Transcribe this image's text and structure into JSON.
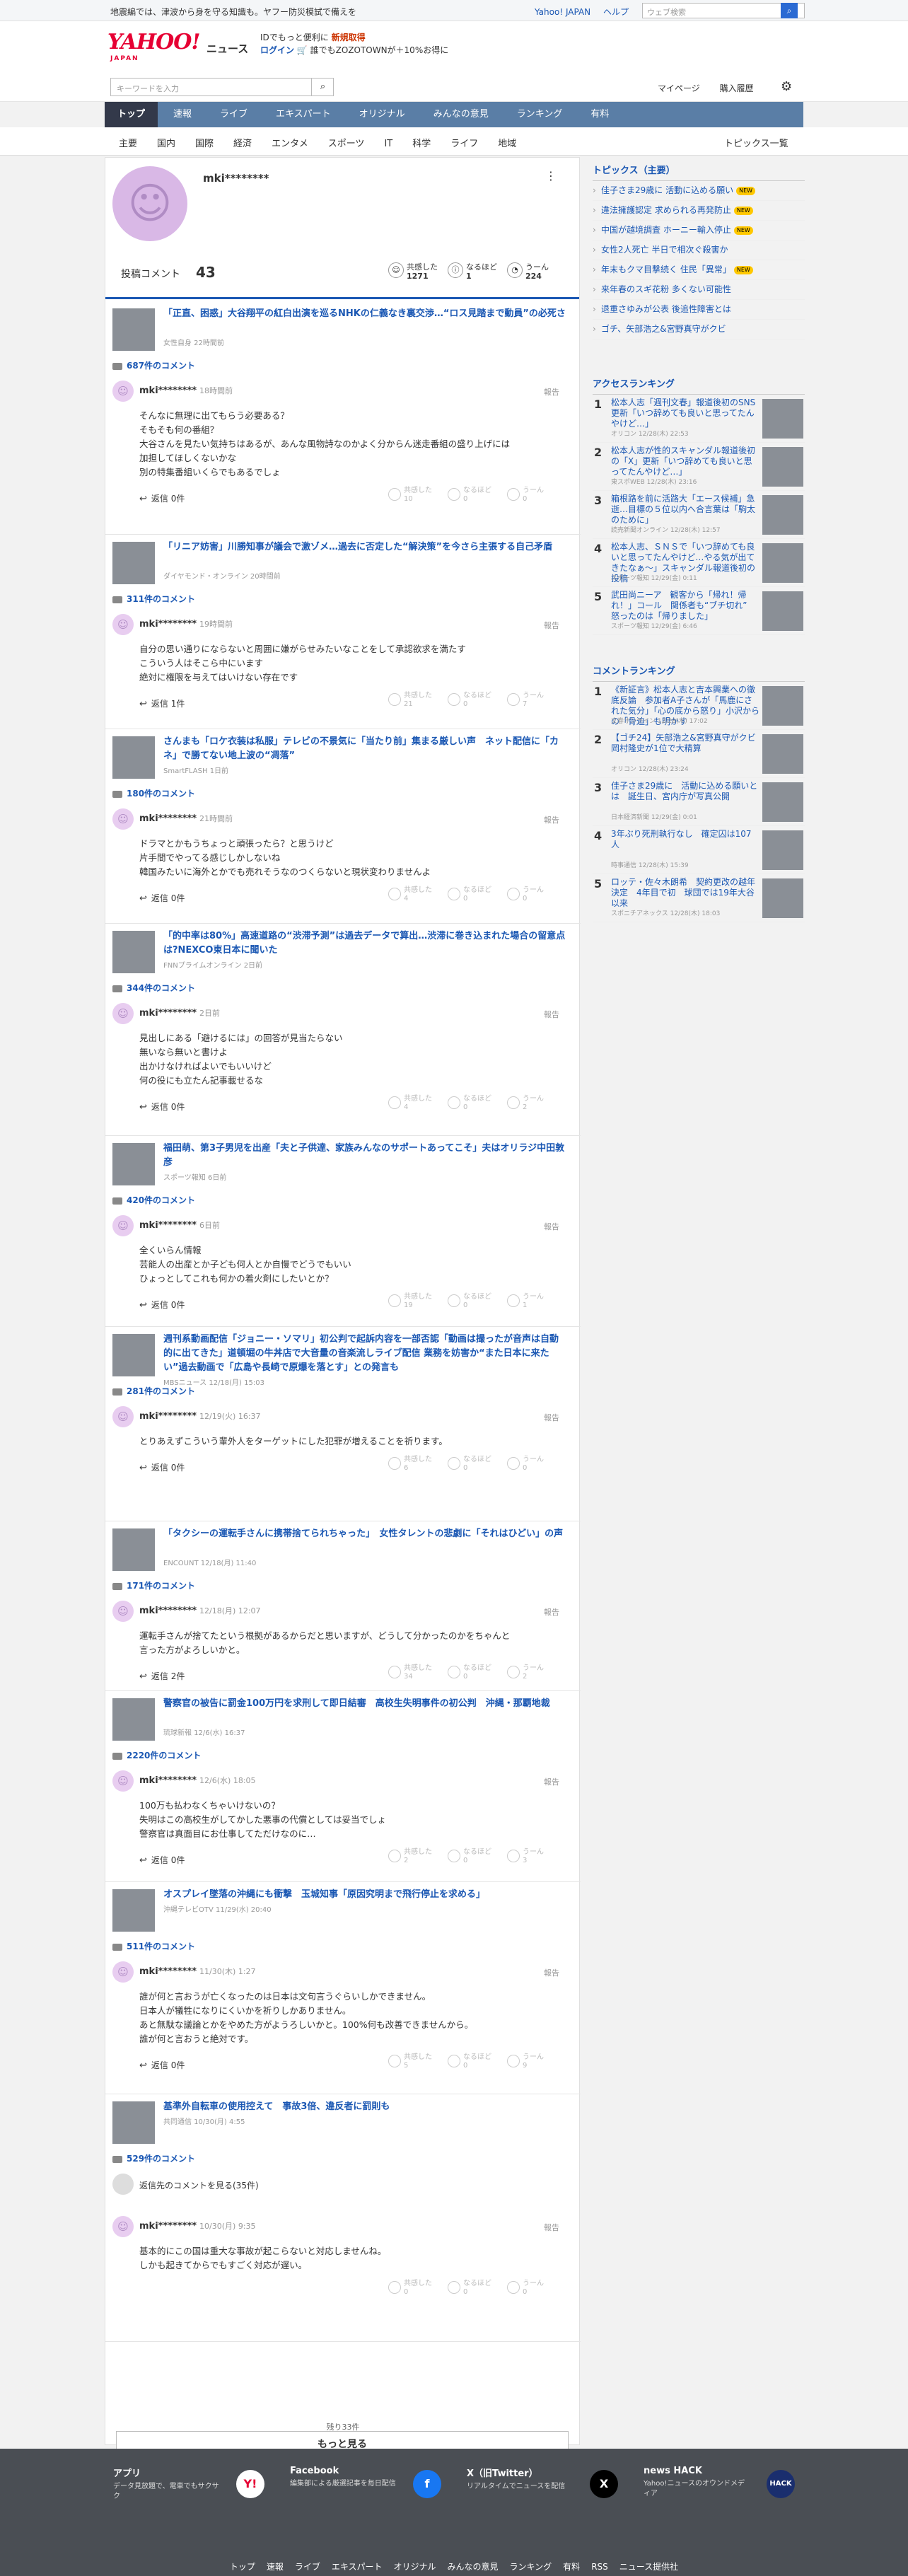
{
  "topbar": {
    "notice": "地震編では、津波から身を守る知識も。ヤフー防災模試で備えを",
    "links": [
      "Yahoo! JAPAN",
      "ヘルプ"
    ],
    "search_placeholder": "ウェブ検索",
    "search_icon": "search-icon"
  },
  "header": {
    "logo": "YAHOO!",
    "logo_sub": "JAPAN",
    "section": "ニュース",
    "promo1": "IDでもっと便利に",
    "promo1b": "新規取得",
    "promo2": "ログイン",
    "promo2b": "🛒 誰でもZOZOTOWNが＋10%お得に"
  },
  "search": {
    "placeholder": "キーワードを入力",
    "links": [
      "マイページ",
      "購入履歴"
    ]
  },
  "nav": [
    "トップ",
    "速報",
    "ライブ",
    "エキスパート",
    "オリジナル",
    "みんなの意見",
    "ランキング",
    "有料"
  ],
  "subnav": [
    "主要",
    "国内",
    "国際",
    "経済",
    "エンタメ",
    "スポーツ",
    "IT",
    "科学",
    "ライフ",
    "地域"
  ],
  "subnav_more": "トピックス一覧",
  "profile": {
    "name": "mki********",
    "label": "投稿コメント",
    "count": "43",
    "r1": "共感した",
    "r1n": "1271",
    "r2": "なるほど",
    "r2n": "1",
    "r3": "うーん",
    "r3n": "224"
  },
  "items": [
    {
      "title": "「正直、困惑」大谷翔平の紅白出演を巡るNHKの仁義なき裏交渉…“ロス見踏まで動員”の必死さ",
      "src": "女性自身 22時間前",
      "count": "687件のコメント",
      "name": "mki********",
      "time": "18時間前",
      "text": [
        "そんなに無理に出てもらう必要ある？",
        "そもそも何の番組？",
        "大谷さんを見たい気持ちはあるが、あんな風物詩なのかよく分からん迷走番組の盛り上げには",
        "加担してほしくないかな",
        "別の特集番組いくらでもあるでしょ"
      ],
      "reply": "返信 0件",
      "v": [
        "10",
        "0",
        "0"
      ]
    },
    {
      "title": "「リニア妨害」川勝知事が議会で激ゾメ…過去に否定した“解決策”を今さら主張する自己矛盾",
      "src": "ダイヤモンド・オンライン 20時間前",
      "count": "311件のコメント",
      "name": "mki********",
      "time": "19時間前",
      "text": [
        "自分の思い通りにならないと周囲に嫌がらせみたいなことをして承認欲求を満たす",
        "こういう人はそこら中にいます",
        "絶対に権限を与えてはいけない存在です"
      ],
      "reply": "返信 1件",
      "v": [
        "21",
        "0",
        "7"
      ]
    },
    {
      "title": "さんまも「ロケ衣装は私服」テレビの不景気に「当たり前」集まる厳しい声　ネット配信に「カネ」で勝てない地上波の“凋落”",
      "src": "SmartFLASH 1日前",
      "count": "180件のコメント",
      "name": "mki********",
      "time": "21時間前",
      "text": [
        "ドラマとかもうちょっと頑張ったら？と思うけど",
        "片手間でやってる感じしかしないね",
        "韓国みたいに海外とかでも売れそうなのつくらないと現状変わりませんよ"
      ],
      "reply": "返信 0件",
      "v": [
        "4",
        "0",
        "0"
      ]
    },
    {
      "title": "「的中率は80%」高速道路の“渋滞予測”は過去データで算出…渋滞に巻き込まれた場合の留意点は?NEXCO東日本に聞いた",
      "src": "FNNプライムオンライン 2日前",
      "count": "344件のコメント",
      "name": "mki********",
      "time": "2日前",
      "text": [
        "見出しにある「避けるには」の回答が見当たらない",
        "無いなら無いと書けよ",
        "出かけなければよいでもいいけど",
        "何の役にも立たん記事載せるな"
      ],
      "reply": "返信 0件",
      "v": [
        "4",
        "0",
        "2"
      ]
    },
    {
      "title": "福田萌、第3子男児を出産「夫と子供達、家族みんなのサポートあってこそ」夫はオリラジ中田敦彦",
      "src": "スポーツ報知 6日前",
      "count": "420件のコメント",
      "name": "mki********",
      "time": "6日前",
      "text": [
        "全くいらん情報",
        "芸能人の出産とか子ども何人とか自慢でどうでもいい",
        "ひょっとしてこれも何かの着火剤にしたいとか？"
      ],
      "reply": "返信 0件",
      "v": [
        "19",
        "0",
        "1"
      ]
    },
    {
      "title": "週刊系動画配信「ジョニー・ソマリ」初公判で起訴内容を一部否認「動画は撮ったが音声は自動的に出てきた」道頓堀の牛丼店で大音量の音楽流しライブ配信 業務を妨害か“また日本に来たい”過去動画で「広島や長崎で原爆を落とす」との発言も",
      "src": "MBSニュース 12/18(月) 15:03",
      "count": "281件のコメント",
      "name": "mki********",
      "time": "12/19(火) 16:37",
      "text": [
        "とりあえずこういう輩外人をターゲットにした犯罪が増えることを祈ります。"
      ],
      "reply": "返信 0件",
      "v": [
        "6",
        "0",
        "0"
      ]
    },
    {
      "title": "「タクシーの運転手さんに携帯捨てられちゃった」　女性タレントの悲劇に「それはひどい」の声",
      "src": "ENCOUNT 12/18(月) 11:40",
      "count": "171件のコメント",
      "name": "mki********",
      "time": "12/18(月) 12:07",
      "text": [
        "運転手さんが捨てたという根拠があるからだと思いますが、どうして分かったのかをちゃんと",
        "言った方がよろしいかと。"
      ],
      "reply": "返信 2件",
      "v": [
        "34",
        "0",
        "2"
      ]
    },
    {
      "title": "警察官の被告に罰金100万円を求刑して即日結審　高校生失明事件の初公判　沖縄・那覇地裁",
      "src": "琉球新報 12/6(水) 16:37",
      "count": "2220件のコメント",
      "name": "mki********",
      "time": "12/6(水) 18:05",
      "text": [
        "100万も払わなくちゃいけないの？",
        "失明はこの高校生がしてかした悪事の代償としては妥当でしょ",
        "警察官は真面目にお仕事してただけなのに…"
      ],
      "reply": "返信 0件",
      "v": [
        "2",
        "0",
        "3"
      ]
    },
    {
      "title": "オスプレイ墜落の沖縄にも衝撃　玉城知事「原因究明まで飛行停止を求める」",
      "src": "沖縄テレビOTV 11/29(水) 20:40",
      "count": "511件のコメント",
      "name": "mki********",
      "time": "11/30(木) 1:27",
      "text": [
        "誰が何と言おうが亡くなったのは日本は文句言うぐらいしかできません。",
        "日本人が犠牲になりにくいかを祈りしかありません。",
        "あと無駄な議論とかをやめた方がようろしいかと。100%何も改善できませんから。",
        "誰が何と言おうと絶対です。"
      ],
      "reply": "返信 0件",
      "v": [
        "5",
        "0",
        "9"
      ]
    },
    {
      "title": "基準外自転車の使用控えて　事故3倍、違反者に罰則も",
      "src": "共同通信 10/30(月) 4:55",
      "count": "529件のコメント",
      "name": "mki********",
      "time": "10/30(月) 9:35",
      "text": [
        "基本的にこの国は重大な事故が起こらないと対応しませんね。",
        "しかも起きてからでもすごく対応が遅い。"
      ],
      "reply": "",
      "v": [
        "0",
        "0",
        "0"
      ],
      "extra": "返信先のコメントを見る(35件)"
    }
  ],
  "remaining": "残り33件",
  "more_button": "もっと見る",
  "topics_title": "トピックス（主要）",
  "topics": [
    {
      "t": "佳子さま29歳に 活動に込める願い",
      "n": true
    },
    {
      "t": "違法擁護認定 求められる再発防止",
      "n": true
    },
    {
      "t": "中国が越境調査 ホーニー輸入停止",
      "n": true
    },
    {
      "t": "女性2人死亡 半日で相次ぐ殺害か",
      "n": false
    },
    {
      "t": "年末もクマ目撃続く 住民「異常」",
      "n": true
    },
    {
      "t": "来年春のスギ花粉 多くない可能性",
      "n": false
    },
    {
      "t": "退重さゆみが公表 後追性障害とは",
      "n": false
    },
    {
      "t": "ゴチ、矢部浩之&宮野真守がクビ",
      "n": false
    }
  ],
  "access_title": "アクセスランキング",
  "access": [
    {
      "t": "松本人志「週刊文春」報道後初のSNS更新「いつ辞めても良いと思ってたんやけど…」",
      "s": "オリコン 12/28(木) 22:53"
    },
    {
      "t": "松本人志が性的スキャンダル報道後初の「X」更新「いつ辞めても良いと思ってたんやけど…」",
      "s": "東スポWEB 12/28(木) 23:16"
    },
    {
      "t": "箱根路を前に活路大「エース候補」急逝…目標の５位以内へ合言葉は「駒太のために」",
      "s": "読売新聞オンライン 12/28(木) 12:57"
    },
    {
      "t": "松本人志、ＳＮＳで「いつ辞めても良いと思ってたんやけど…やる気が出てきたなぁ〜」スキャンダル報道後初の投稿",
      "s": "スポーツ報知 12/29(金) 0:11"
    },
    {
      "t": "武田尚ニーア　観客から「帰れ！帰れ！」コール　関係者も“ブチ切れ”　怒ったのは「帰りました」",
      "s": "スポーツ報知 12/29(金) 6:46"
    }
  ],
  "comment_title": "コメントランキング",
  "crank": [
    {
      "t": "《新証言》松本人志と吉本興業への徹底反論　参加者A子さんが「馬鹿にされた気分」「心の底から怒り」小沢からの「骨迫」も明かす",
      "s": "文春オンライン 12/28(木) 17:02"
    },
    {
      "t": "【ゴチ24】矢部浩之&宮野真守がクビ　岡村隆史が1位で大精算",
      "s": "オリコン 12/28(木) 23:24"
    },
    {
      "t": "佳子さま29歳に　活動に込める願いとは　誕生日、宮内庁が写真公開",
      "s": "日本経済新聞 12/29(金) 0:01"
    },
    {
      "t": "3年ぶり死刑執行なし　確定囚は107人",
      "s": "時事通信 12/28(木) 15:39"
    },
    {
      "t": "ロッテ・佐々木朗希　契約更改の越年決定　4年目で初　球団では19年大谷以来",
      "s": "スポニチアネックス 12/28(木) 18:03"
    }
  ],
  "footer": [
    {
      "t": "アプリ",
      "d": "データ見放題で、電車でもサクサク",
      "l": "Y!"
    },
    {
      "t": "Facebook",
      "d": "編集部による厳選記事を毎日配信",
      "l": "f"
    },
    {
      "t": "X（旧Twitter）",
      "d": "リアルタイムでニュースを配信",
      "l": "X"
    },
    {
      "t": "news HACK",
      "d": "Yahoo!ニュースのオウンドメディア",
      "l": "HACK"
    }
  ],
  "footer_links": [
    "トップ",
    "速報",
    "ライブ",
    "エキスパート",
    "オリジナル",
    "みんなの意見",
    "ランキング",
    "有料",
    "RSS",
    "ニュース提供社"
  ],
  "colors": {
    "accent": "#1a57b3",
    "nav": "#5a7ea6",
    "nav_active": "#33394a",
    "brand": "#e60033"
  }
}
